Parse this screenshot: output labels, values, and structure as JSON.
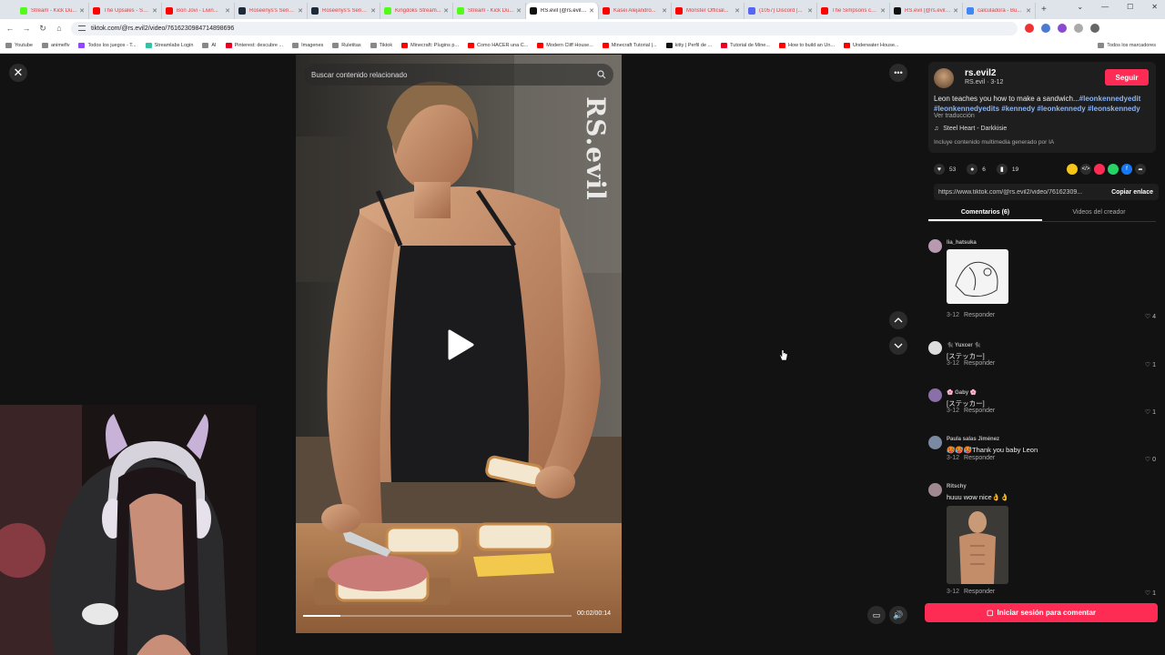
{
  "browser": {
    "tabs": [
      {
        "label": "Stream - Kick Du...",
        "color": "#53fc18"
      },
      {
        "label": "The Upsales - Sam...",
        "color": "#ff0000"
      },
      {
        "label": "Bon Jovi - Livin...",
        "color": "#ff0000"
      },
      {
        "label": "Roseenys's Serie...",
        "color": "#1e2a3a"
      },
      {
        "label": "Roseenys's Serie...",
        "color": "#1e2a3a"
      },
      {
        "label": "Kingdoks Stream...",
        "color": "#53fc18"
      },
      {
        "label": "Stream - Kick Du...",
        "color": "#53fc18"
      },
      {
        "label": "RS.evil (@rs.evil2...",
        "color": "#111111",
        "active": true
      },
      {
        "label": "Kasei Alejandro...",
        "color": "#ff0000"
      },
      {
        "label": "Monster Official...",
        "color": "#ff0000"
      },
      {
        "label": "(1057) Discord |...",
        "color": "#5865f2"
      },
      {
        "label": "The Simpsons ca...",
        "color": "#ff0000"
      },
      {
        "label": "RS.evil (@rs.evil2...",
        "color": "#111111"
      },
      {
        "label": "calculadora - Bu...",
        "color": "#4285f4"
      }
    ],
    "url": "tiktok.com/@rs.evil2/video/7616230984714898696",
    "bookmarks": [
      {
        "label": "Youtube",
        "color": "#888"
      },
      {
        "label": "animeflv",
        "color": "#888"
      },
      {
        "label": "Todos los juegos - T...",
        "color": "#9146ff"
      },
      {
        "label": "Streamlabs Login",
        "color": "#31c3a2"
      },
      {
        "label": "AI",
        "color": "#888"
      },
      {
        "label": "Pinterest: descubre ...",
        "color": "#e60023"
      },
      {
        "label": "Imagenes",
        "color": "#888"
      },
      {
        "label": "Ruletitas",
        "color": "#888"
      },
      {
        "label": "Tiktok",
        "color": "#888"
      },
      {
        "label": "Minecraft: Plugins p...",
        "color": "#ff0000"
      },
      {
        "label": "Como HACER una C...",
        "color": "#ff0000"
      },
      {
        "label": "Modern Cliff House...",
        "color": "#ff0000"
      },
      {
        "label": "Minecraft Tutorial |...",
        "color": "#ff0000"
      },
      {
        "label": "kitty | Perfil de ...",
        "color": "#111"
      },
      {
        "label": "Tutorial de Mine...",
        "color": "#e60023"
      },
      {
        "label": "How to build an Un...",
        "color": "#ff0000"
      },
      {
        "label": "Underwater House...",
        "color": "#ff0000"
      }
    ],
    "all_bookmarks": "Todos los marcadores"
  },
  "video": {
    "search_placeholder": "Buscar contenido relacionado",
    "watermark": "RS.evil",
    "time": "00:02/00:14",
    "progress": 0.14
  },
  "panel": {
    "username": "rs.evil2",
    "subname": "RS.evil · 3-12",
    "follow": "Seguir",
    "desc_text": "Leon teaches you how to make a sandwich...",
    "desc_tags": "#leonkennedyedit #leonkennedyedits #kennedy #leonkennedy #leonskennedy",
    "translate": "Ver traducción",
    "music": "Steel Heart - Darkkisie",
    "ai_note": "Incluye contenido multimedia generado por IA",
    "likes": "53",
    "comments": "6",
    "saves": "19",
    "link": "https://www.tiktok.com/@rs.evil2/video/76162309...",
    "copy": "Copiar enlace",
    "tab_comments": "Comentarios (6)",
    "tab_creator": "Videos del creador",
    "login": "Iniciar sesión para comentar"
  },
  "comments": [
    {
      "name": "lia_hatsuka",
      "text": "",
      "date": "3-12",
      "reply": "Responder",
      "likes": "4",
      "color": "#b89ab0"
    },
    {
      "name": "🐈‍⬛ Yuxcer 🐈‍⬛",
      "text": "[ステッカー]",
      "date": "3-12",
      "reply": "Responder",
      "likes": "1",
      "color": "#ddd"
    },
    {
      "name": "🌸 Gaby 🌸",
      "text": "[ステッカー]",
      "date": "3-12",
      "reply": "Responder",
      "likes": "1",
      "color": "#8a6fa8"
    },
    {
      "name": "Paula salas Jiménez",
      "text": "🥵🥵🥵Thank you baby Leon",
      "date": "3-12",
      "reply": "Responder",
      "likes": "0",
      "color": "#7a8aa0"
    },
    {
      "name": "Ritschy",
      "text": "huuu wow nice👌👌",
      "date": "3-12",
      "reply": "Responder",
      "likes": "1",
      "color": "#a08890"
    }
  ]
}
